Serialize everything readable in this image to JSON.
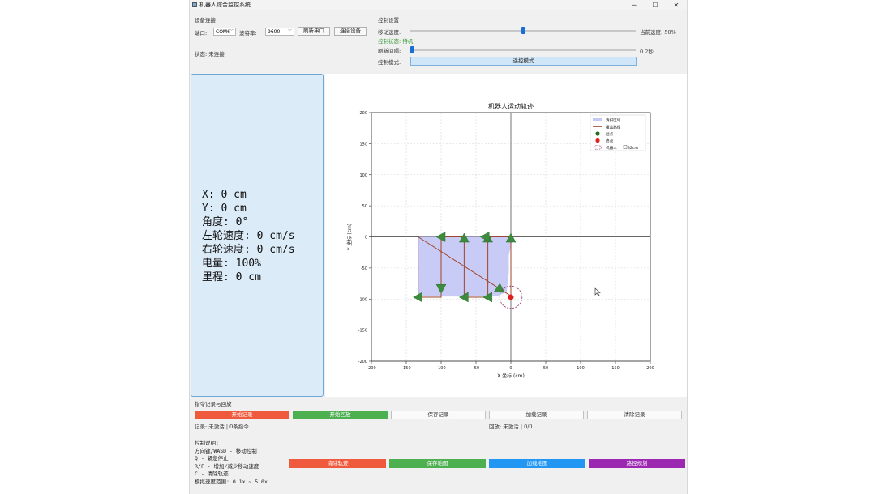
{
  "window": {
    "title": "机器人综合监控系统",
    "minimize": "─",
    "maximize": "☐",
    "close": "✕"
  },
  "connection": {
    "section_title": "设备连接",
    "port_label": "端口:",
    "port_value": "COM6",
    "baud_label": "波特率:",
    "baud_value": "9600",
    "refresh_button": "刷新串口",
    "connect_button": "连接设备",
    "status_text": "状态: 未连接"
  },
  "control": {
    "section_title": "控制设置",
    "speed_label": "移动速度:",
    "speed_value_text": "当前速度: 50%",
    "speed_fraction": 0.5,
    "control_status": "控制状态: 待机",
    "refresh_label": "刷新间隔:",
    "refresh_value_text": "0.2秒",
    "refresh_fraction": 0.0,
    "mode_label": "控制模式:",
    "mode_button": "遥控模式"
  },
  "status": {
    "x": "X: 0 cm",
    "y": "Y: 0 cm",
    "angle": "角度: 0°",
    "left_speed": "左轮速度: 0 cm/s",
    "right_speed": "右轮速度: 0 cm/s",
    "battery": "电量: 100%",
    "mileage": "里程: 0 cm"
  },
  "record": {
    "section_title": "指令记录与回放",
    "start_record": "开始记录",
    "start_replay": "开始回放",
    "save_record": "保存记录",
    "load_record": "加载记录",
    "clear_record": "清除记录",
    "record_status": "记录: 未激活 | 0条指令",
    "replay_status": "回放: 未激活 | 0/0"
  },
  "help": {
    "title": "控制说明:",
    "line1": "方向键/WASD - 移动控制",
    "line2": "Q - 紧急停止",
    "line3": "R/F - 增加/减少移动速度",
    "line4": "C - 清除轨迹",
    "line5": "模拟速度范围: 0.1x ~ 5.0x"
  },
  "actions": {
    "clear_track": "清除轨迹",
    "save_map": "保存地图",
    "load_map": "加载地图",
    "path_plan": "路径规划"
  },
  "colors": {
    "red": "#f05a3c",
    "green": "#4caf50",
    "blue": "#2196f3",
    "purple": "#9c27b0",
    "mode_button": "#cfe6f8",
    "status_panel": "#dcebf8"
  },
  "chart_data": {
    "type": "line",
    "title": "机器人运动轨迹",
    "xlabel": "X 坐标 (cm)",
    "ylabel": "Y 坐标 (cm)",
    "xlim": [
      -200,
      200
    ],
    "ylim": [
      -200,
      200
    ],
    "xticks": [
      -200,
      -150,
      -100,
      -50,
      0,
      50,
      100,
      150,
      200
    ],
    "yticks": [
      -200,
      -150,
      -100,
      -50,
      0,
      50,
      100,
      150,
      200
    ],
    "grid": true,
    "legend_placement": "top-right",
    "legend": [
      "清扫区域",
      "覆盖路径",
      "起点",
      "终点",
      "机器人"
    ],
    "legend_extra": "32cm",
    "covered_area": [
      [
        -133,
        0
      ],
      [
        0,
        0
      ],
      [
        1,
        -10
      ],
      [
        -3,
        -30
      ],
      [
        -3,
        -58
      ],
      [
        -6,
        -88
      ],
      [
        -20,
        -96
      ],
      [
        -133,
        -96
      ]
    ],
    "path": [
      [
        0,
        -95
      ],
      [
        -133,
        0
      ],
      [
        -133,
        -97
      ],
      [
        -100,
        -97
      ],
      [
        -100,
        0
      ],
      [
        -67,
        0
      ],
      [
        -67,
        -97
      ],
      [
        -33,
        -97
      ],
      [
        -33,
        0
      ],
      [
        0,
        0
      ],
      [
        0,
        -95
      ]
    ],
    "arrows": [
      {
        "x": -133,
        "y": -97,
        "dir": "left"
      },
      {
        "x": -100,
        "y": 0,
        "dir": "left"
      },
      {
        "x": -100,
        "y": -83,
        "dir": "down"
      },
      {
        "x": -67,
        "y": -2,
        "dir": "up"
      },
      {
        "x": -67,
        "y": -97,
        "dir": "left"
      },
      {
        "x": -33,
        "y": -97,
        "dir": "left"
      },
      {
        "x": -33,
        "y": -2,
        "dir": "up"
      },
      {
        "x": -37,
        "y": 0,
        "dir": "left"
      },
      {
        "x": 0,
        "y": -2,
        "dir": "up"
      },
      {
        "x": -15,
        "y": -85,
        "dir": "down-right"
      }
    ],
    "start": [
      0,
      -97
    ],
    "end": [
      0,
      -97
    ],
    "robot": {
      "x": 0,
      "y": -97,
      "radius": 16
    }
  }
}
